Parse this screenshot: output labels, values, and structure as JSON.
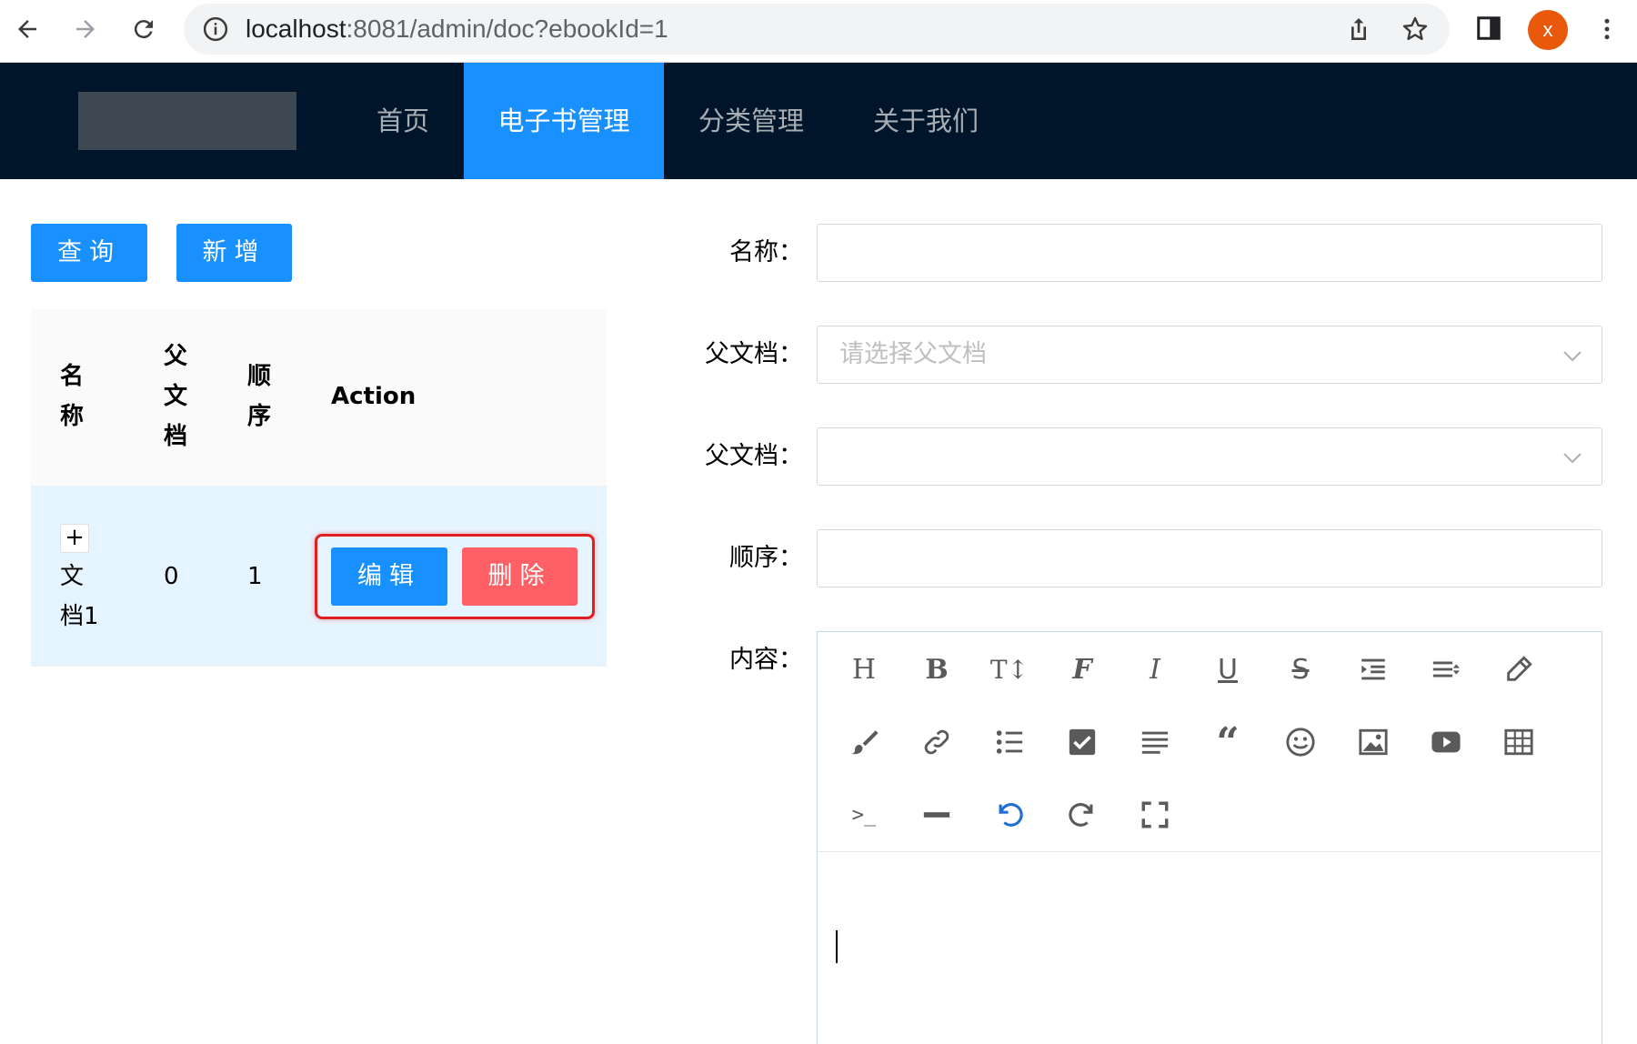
{
  "browser": {
    "url_host": "localhost",
    "url_rest": ":8081/admin/doc?ebookId=1",
    "avatar_letter": "x",
    "icons": [
      "back-icon",
      "forward-icon",
      "reload-icon",
      "info-icon",
      "share-icon",
      "star-icon",
      "side-panel-icon",
      "kebab-menu-icon"
    ]
  },
  "header": {
    "menu": [
      {
        "label": "首页",
        "active": false
      },
      {
        "label": "电子书管理",
        "active": true
      },
      {
        "label": "分类管理",
        "active": false
      },
      {
        "label": "关于我们",
        "active": false
      }
    ],
    "colors": {
      "background": "#001529",
      "active": "#1890ff"
    }
  },
  "toolbar": {
    "query_label": "查询",
    "add_label": "新增"
  },
  "table": {
    "columns": [
      "名称",
      "父文档",
      "顺序",
      "Action"
    ],
    "rows": [
      {
        "expand": "+",
        "name": "文档1",
        "parent": "0",
        "sort": "1",
        "edit_label": "编辑",
        "delete_label": "删除"
      }
    ]
  },
  "form": {
    "name_label": "名称：",
    "parent_label": "父文档：",
    "parent_placeholder": "请选择父文档",
    "parent2_label": "父文档：",
    "sort_label": "顺序：",
    "content_label": "内容：",
    "name_value": "",
    "sort_value": ""
  },
  "editor": {
    "tools": [
      "heading-icon",
      "bold-icon",
      "font-size-icon",
      "font-family-icon",
      "italic-icon",
      "underline-icon",
      "strikethrough-icon",
      "indent-icon",
      "line-height-icon",
      "highlight-pen-icon",
      "paint-brush-icon",
      "link-icon",
      "bulleted-list-icon",
      "todo-checkbox-icon",
      "justify-icon",
      "quote-icon",
      "emoji-icon",
      "image-icon",
      "video-icon",
      "table-icon",
      "code-icon",
      "divider-icon",
      "undo-icon",
      "redo-icon",
      "fullscreen-icon"
    ],
    "accent": "#1890ff",
    "delete_color": "#ff6066"
  }
}
